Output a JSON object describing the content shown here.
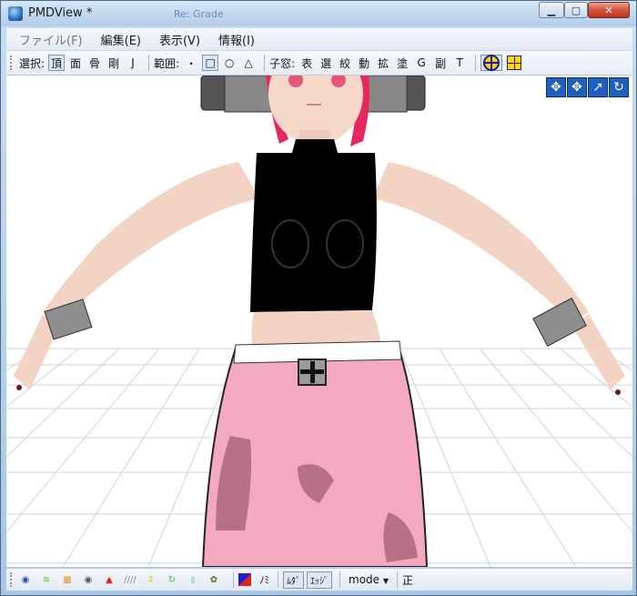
{
  "window": {
    "title": "PMDView *",
    "title_blur": "Re: Grade",
    "minimize_label": "▁",
    "maximize_label": "▢",
    "close_label": "✕"
  },
  "menu": [
    {
      "label": "ファイル(F)",
      "dim": true
    },
    {
      "label": "編集(E)",
      "dim": false
    },
    {
      "label": "表示(V)",
      "dim": false
    },
    {
      "label": "情報(I)",
      "dim": false
    }
  ],
  "toolbar": {
    "select_label": "選択:",
    "select_items": [
      "頂",
      "面",
      "骨",
      "剛",
      "J"
    ],
    "range_label": "範囲:",
    "range_items": [
      "・",
      "□",
      "○",
      "△"
    ],
    "child_label": "子窓:",
    "child_items": [
      "表",
      "選",
      "絞",
      "動",
      "拡",
      "塗",
      "G",
      "副",
      "T"
    ]
  },
  "view_controls": [
    "✥",
    "✥",
    "↗",
    "↻"
  ],
  "bottom": {
    "icons": [
      "◉",
      "≋",
      "▩",
      "◉",
      "▲",
      "////",
      "↕",
      "↻",
      "▮",
      "✿"
    ],
    "color_label": "ﾉﾐ",
    "mode_toggle": "ﾑﾀﾞ",
    "edge_toggle": "ｴｯｼﾞ",
    "mode_select": "mode",
    "mode_arrow": "▼",
    "right_label": "正"
  },
  "colors": {
    "skin": "#f3d3c3",
    "top": "#000000",
    "pants": "#f5a9c0",
    "hair": "#e8265f",
    "accent": "#1f5fbf"
  }
}
